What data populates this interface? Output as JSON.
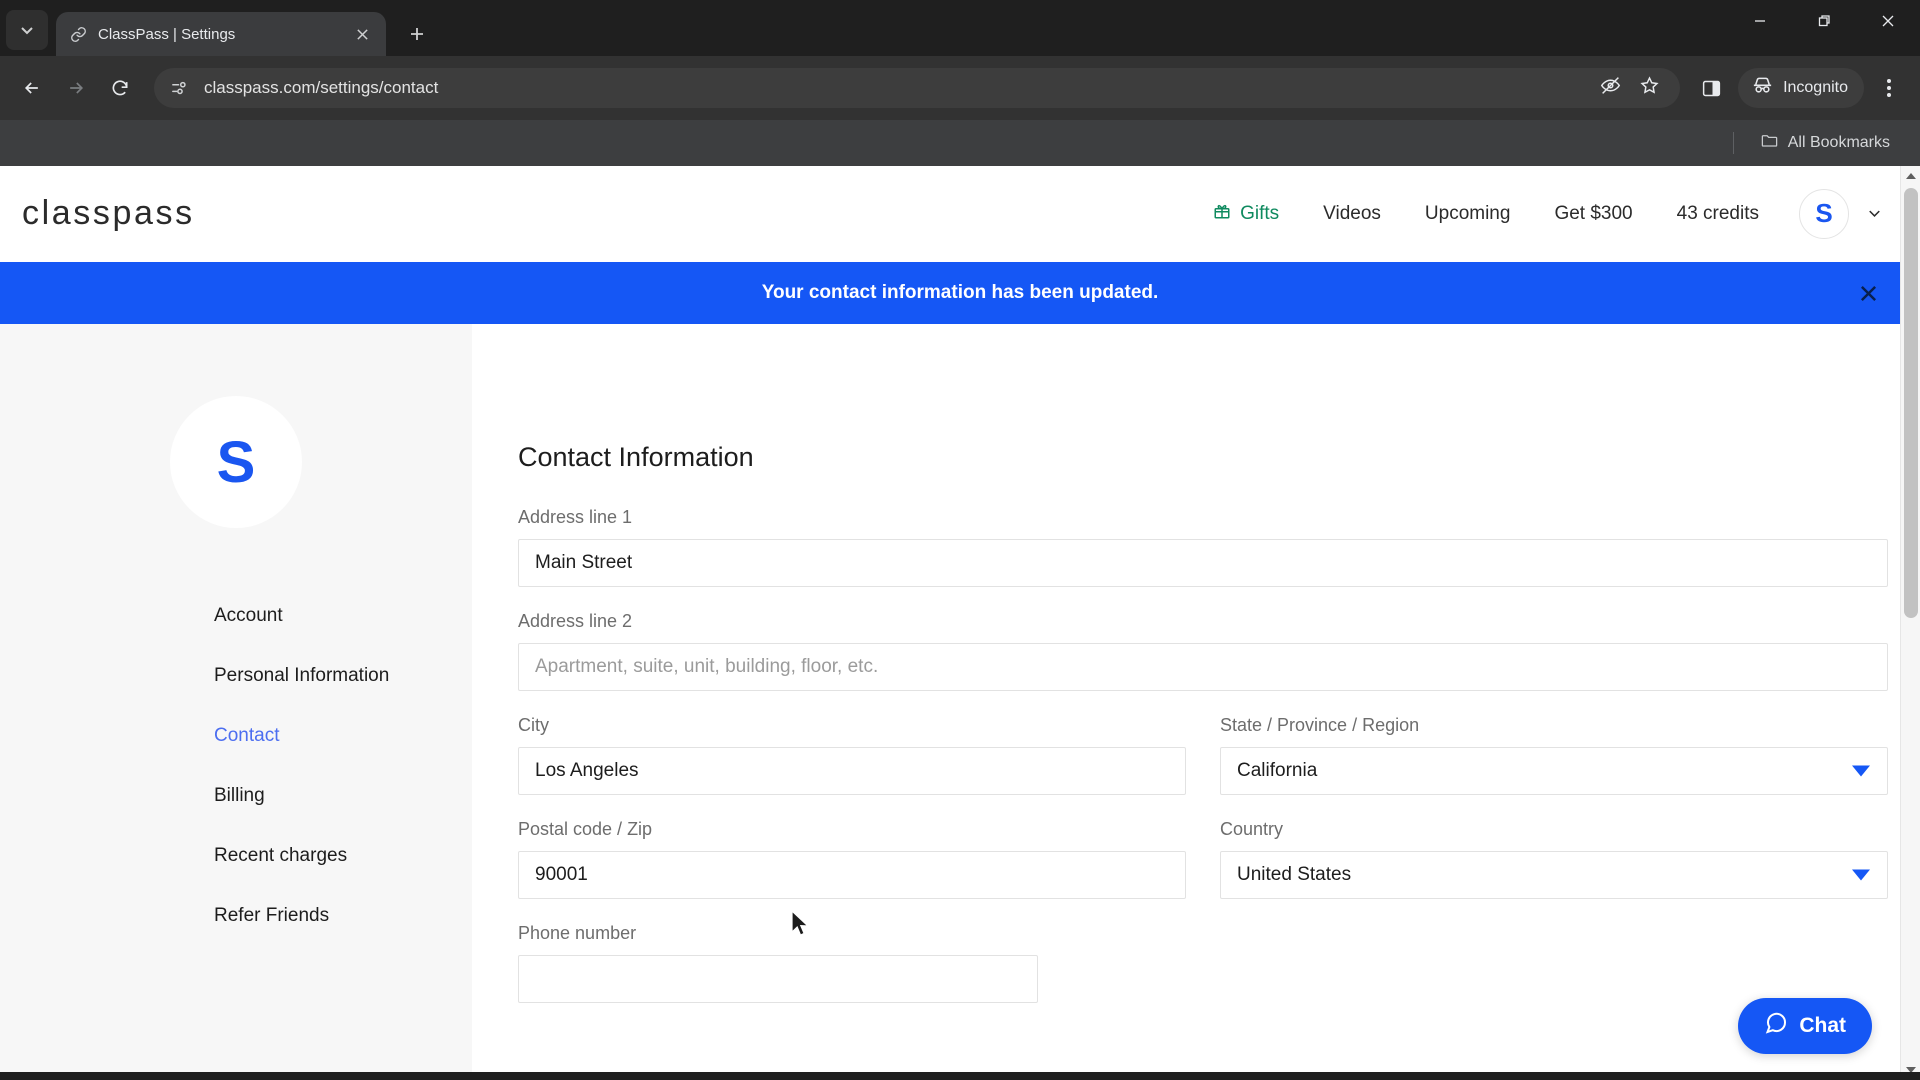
{
  "browser": {
    "tab": {
      "title": "ClassPass | Settings",
      "favicon": "link-icon"
    },
    "new_tab_label": "+",
    "url": "classpass.com/settings/contact",
    "omnibox_icons": [
      "page-info-icon",
      "hide-password-icon",
      "bookmark-star-icon"
    ],
    "toolbar_icons": [
      "side-panel-icon"
    ],
    "incognito_label": "Incognito",
    "menu_label": "chrome-menu-icon",
    "bookmarks": {
      "label": "All Bookmarks",
      "icon": "folder-icon"
    },
    "window_controls": [
      "minimize",
      "maximize",
      "close"
    ]
  },
  "site": {
    "logo": "classpass",
    "nav": [
      {
        "label": "Gifts",
        "icon": "gift-icon",
        "color": "#0f8a5f"
      },
      {
        "label": "Videos"
      },
      {
        "label": "Upcoming"
      },
      {
        "label": "Get $300"
      },
      {
        "label": "43 credits"
      }
    ],
    "avatar_initial": "S",
    "account_caret": "chevron-down-icon"
  },
  "banner": {
    "message": "Your contact information has been updated.",
    "background": "#1557f5",
    "close_icon": "close-icon"
  },
  "sidebar": {
    "avatar_initial": "S",
    "items": [
      {
        "label": "Account",
        "active": false
      },
      {
        "label": "Personal Information",
        "active": false
      },
      {
        "label": "Contact",
        "active": true
      },
      {
        "label": "Billing",
        "active": false
      },
      {
        "label": "Recent charges",
        "active": false
      },
      {
        "label": "Refer Friends",
        "active": false
      }
    ],
    "active_color": "#4c6ef0"
  },
  "form": {
    "title": "Contact Information",
    "address1": {
      "label": "Address line 1",
      "value": "Main Street"
    },
    "address2": {
      "label": "Address line 2",
      "value": "",
      "placeholder": "Apartment, suite, unit, building, floor, etc."
    },
    "city": {
      "label": "City",
      "value": "Los Angeles"
    },
    "state": {
      "label": "State / Province / Region",
      "value": "California"
    },
    "postal": {
      "label": "Postal code / Zip",
      "value": "90001"
    },
    "country": {
      "label": "Country",
      "value": "United States"
    },
    "phone": {
      "label": "Phone number",
      "value": ""
    }
  },
  "chat": {
    "label": "Chat",
    "icon": "chat-bubble-icon",
    "color": "#1557f5"
  }
}
